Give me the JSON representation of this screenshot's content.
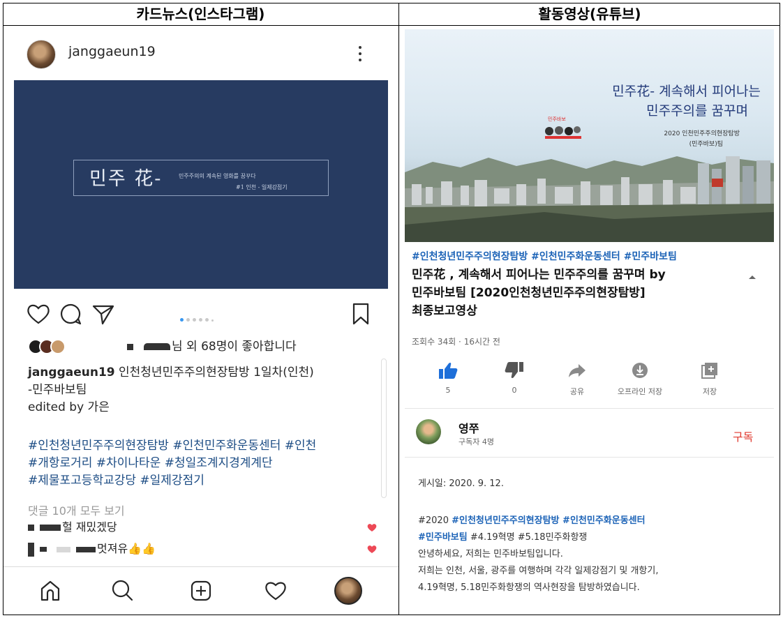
{
  "headers": {
    "left": "카드뉴스(인스타그램)",
    "right": "활동영상(유튜브)"
  },
  "instagram": {
    "username": "janggaeun19",
    "card": {
      "title": "민주 花-",
      "subtitle": "민주주의의 계속된 영화를 꿈꾸다",
      "tag": "#1 인천 - 일제강점기"
    },
    "likes_text": "님 외 68명이 좋아합니다",
    "caption_user": "janggaeun19",
    "caption_text": " 인천청년민주주의현장탐방 1일차(인천)",
    "caption_line2": "-민주바보팀",
    "edited_by": "edited by 가은",
    "hashtags": [
      "#인천청년민주주의현장탐방 #인천민주화운동센터 #인천",
      "#개항로거리 #차이나타운 #청일조계지경계계단",
      "#제물포고등학교강당 #일제강점기"
    ],
    "view_comments": "댓글 10개 모두 보기",
    "comments": [
      {
        "text": "헐 재밌겠당"
      },
      {
        "text": "멋져유👍👍"
      }
    ],
    "colors": {
      "card_bg": "#273b61",
      "hashtag": "#1c4c84",
      "heart": "#ed4956",
      "dot_active": "#3897f0"
    }
  },
  "youtube": {
    "thumb": {
      "line1": "민주花- 계속해서 피어나는",
      "line2": "민주주의를 꿈꾸며",
      "line3": "2020 인천민주주의현장탐방",
      "line4": "(민주바보)팀"
    },
    "hashtags": "#인천청년민주주의현장탐방 #인천민주화운동센터 #민주바보팀",
    "title_lines": [
      "민주花 , 계속해서 피어나는 민주주의를 꿈꾸며 by",
      "민주바보팀 [2020인천청년민주주의현장탐방]",
      "최종보고영상"
    ],
    "views": "조회수 34회 · 16시간 전",
    "actions": [
      {
        "icon": "thumbs-up-icon",
        "label": "5"
      },
      {
        "icon": "thumbs-down-icon",
        "label": "0"
      },
      {
        "icon": "share-icon",
        "label": "공유"
      },
      {
        "icon": "download-icon",
        "label": "오프라인 저장"
      },
      {
        "icon": "save-playlist-icon",
        "label": "저장"
      }
    ],
    "channel_name": "영쭈",
    "subscribers": "구독자 4명",
    "subscribe_label": "구독",
    "post_date": "게시일: 2020. 9. 12.",
    "desc": {
      "l1_prefix": "#2020 ",
      "l1_tags": "#인천청년민주주의현장탐방 #인천민주화운동센터",
      "l2_tag": "#민주바보팀",
      "l2_rest": " #4.19혁명 #5.18민주화항쟁",
      "l3": "안녕하세요, 저희는 민주바보팀입니다.",
      "l4": "저희는 인천, 서울, 광주를 여행하며 각각 일제강점기 및 개항기,",
      "l5": "4.19혁명, 5.18민주화항쟁의 역사현장을 탐방하였습니다."
    },
    "colors": {
      "link": "#1c63b7",
      "subscribe": "#e03a2f",
      "like_active": "#1e6fd9"
    }
  }
}
